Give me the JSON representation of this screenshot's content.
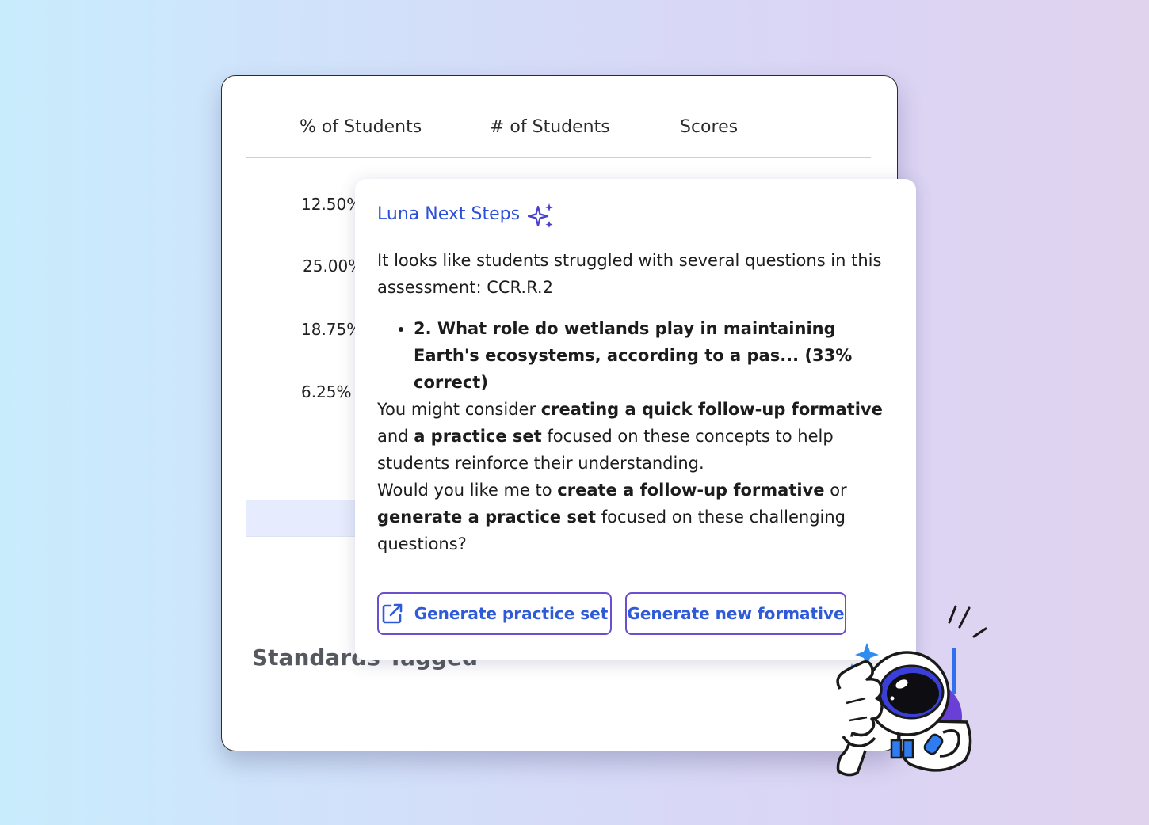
{
  "table": {
    "headers": [
      "% of Students",
      "# of Students",
      "Scores"
    ],
    "percentages": [
      "12.50%",
      "25.00%",
      "18.75%",
      "6.25%"
    ]
  },
  "standards": {
    "title": "Standards Tagged"
  },
  "popover": {
    "title": "Luna Next Steps",
    "intro": "It looks like students struggled with several questions in this assessment: CCR.R.2",
    "question": "2. What role do wetlands play in maintaining Earth's ecosystems, according to a pas... (33% correct)",
    "p2_a": "You might consider ",
    "p2_b": "creating a quick follow-up formative",
    "p2_c": " and ",
    "p2_d": "a practice set",
    "p2_e": " focused on these concepts to help students reinforce their understanding.",
    "p3_a": "Would you like me to ",
    "p3_b": "create a follow-up formative",
    "p3_c": " or ",
    "p3_d": "generate a practice set",
    "p3_e": " focused on these challenging questions?",
    "btn_practice": "Generate practice set",
    "btn_formative": "Generate new formative"
  },
  "colors": {
    "accent": "#2b4fd8",
    "button_border": "#6b4fd0",
    "sparkle": "#4a3fd0"
  },
  "icons": [
    "sparkle-icon",
    "external-link-icon",
    "astronaut-mascot-icon"
  ]
}
